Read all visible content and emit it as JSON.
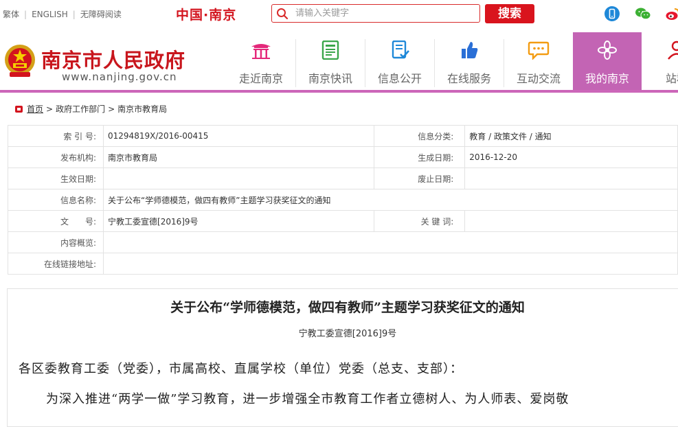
{
  "top": {
    "links": [
      "繁体",
      "ENGLISH",
      "无障碍阅读"
    ],
    "brand": "中国·南京",
    "search_placeholder": "请输入关键字",
    "search_button": "搜索"
  },
  "header": {
    "site_name": "南京市人民政府",
    "site_url": "www.nanjing.gov.cn",
    "nav": [
      {
        "label": "走近南京",
        "icon": "pavilion-icon"
      },
      {
        "label": "南京快讯",
        "icon": "newspaper-icon"
      },
      {
        "label": "信息公开",
        "icon": "document-check-icon"
      },
      {
        "label": "在线服务",
        "icon": "thumbs-up-icon"
      },
      {
        "label": "互动交流",
        "icon": "chat-bubble-icon"
      },
      {
        "label": "我的南京",
        "icon": "flower-icon"
      },
      {
        "label": "站群",
        "icon": "person-icon"
      }
    ],
    "active_nav": "我的南京",
    "accent_color": "#c364b4",
    "brand_color": "#d9141d"
  },
  "breadcrumb": {
    "home": "首页",
    "items": [
      "政府工作部门",
      "南京市教育局"
    ]
  },
  "info": {
    "rows": [
      {
        "l1": "索 引 号:",
        "v1": "01294819X/2016-00415",
        "l2": "信息分类:",
        "v2": "教育 / 政策文件 / 通知"
      },
      {
        "l1": "发布机构:",
        "v1": "南京市教育局",
        "l2": "生成日期:",
        "v2": "2016-12-20"
      },
      {
        "l1": "生效日期:",
        "v1": "",
        "l2": "废止日期:",
        "v2": ""
      },
      {
        "l1": "信息名称:",
        "v1": "关于公布“学师德模范，做四有教师”主题学习获奖征文的通知"
      },
      {
        "l1": "文　　号:",
        "v1": "宁教工委宣德[2016]9号",
        "l2": "关 键 词:",
        "v2": ""
      },
      {
        "l1": "内容概览:",
        "v1": ""
      },
      {
        "l1": "在线链接地址:",
        "v1": ""
      }
    ]
  },
  "article": {
    "title": "关于公布“学师德模范，做四有教师”主题学习获奖征文的通知",
    "doc_no": "宁教工委宣德[2016]9号",
    "p1": "各区委教育工委（党委），市属高校、直属学校（单位）党委（总支、支部）：",
    "p2": "为深入推进“两学一做”学习教育，进一步增强全市教育工作者立德树人、为人师表、爱岗敬"
  }
}
